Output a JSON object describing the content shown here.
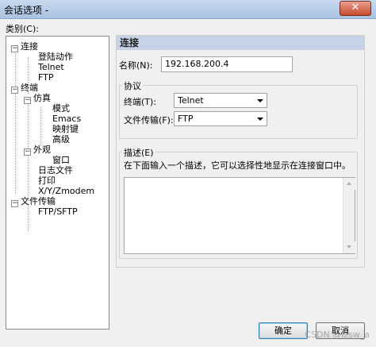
{
  "window": {
    "title": "会话选项 -",
    "close_label": "✕"
  },
  "sidebar": {
    "category_label": "类别(C):",
    "tree": [
      {
        "label": "连接",
        "expander": "−"
      },
      {
        "label": "登陆动作"
      },
      {
        "label": "Telnet"
      },
      {
        "label": "FTP"
      },
      {
        "label": "终端",
        "expander": "−"
      },
      {
        "label": "仿真",
        "expander": "−"
      },
      {
        "label": "模式"
      },
      {
        "label": "Emacs"
      },
      {
        "label": "映射键"
      },
      {
        "label": "高级"
      },
      {
        "label": "外观",
        "expander": "−"
      },
      {
        "label": "窗口"
      },
      {
        "label": "日志文件"
      },
      {
        "label": "打印"
      },
      {
        "label": "X/Y/Zmodem"
      },
      {
        "label": "文件传输",
        "expander": "−"
      },
      {
        "label": "FTP/SFTP"
      }
    ]
  },
  "main": {
    "header": "连接",
    "name_label": "名称(N):",
    "name_value": "192.168.200.4",
    "protocol_group": "协议",
    "terminal_label": "终端(T):",
    "terminal_value": "Telnet",
    "file_transfer_label": "文件传输(F):",
    "file_transfer_value": "FTP",
    "description_group": "描述(E)",
    "description_hint": "在下面输入一个描述，它可以选择性地显示在连接窗口中。",
    "description_value": ""
  },
  "buttons": {
    "ok": "确定",
    "cancel": "取消"
  },
  "watermark": "CSDN @lzsw_a"
}
